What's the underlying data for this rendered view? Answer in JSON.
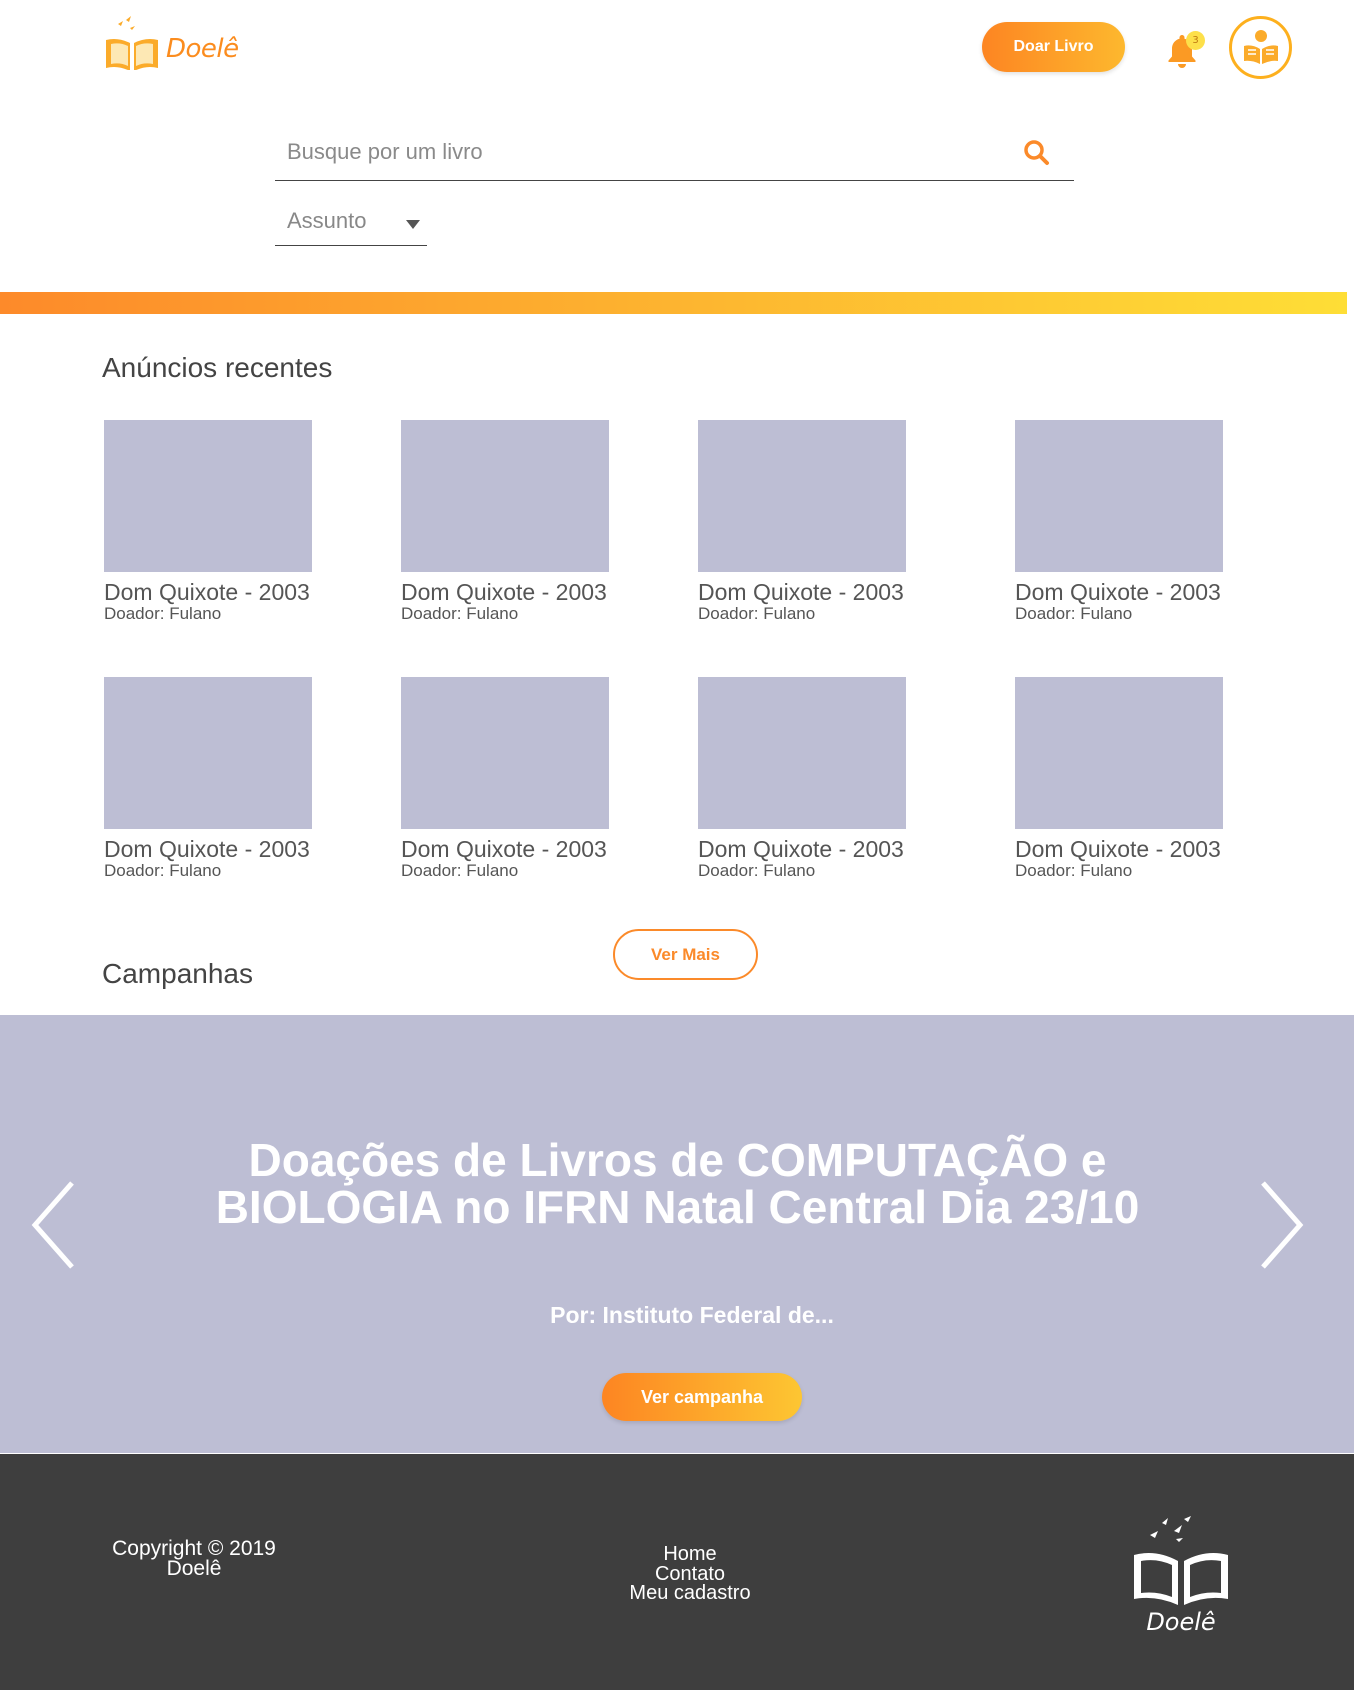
{
  "header": {
    "logo_text": "Doelê",
    "donate_button": "Doar Livro",
    "notification_count": "3"
  },
  "search": {
    "placeholder": "Busque por um livro",
    "subject_label": "Assunto"
  },
  "recent": {
    "title": "Anúncios recentes",
    "books": [
      {
        "title": "Dom Quixote - 2003",
        "donor": "Doador: Fulano"
      },
      {
        "title": "Dom Quixote - 2003",
        "donor": "Doador: Fulano"
      },
      {
        "title": "Dom Quixote - 2003",
        "donor": "Doador: Fulano"
      },
      {
        "title": "Dom Quixote - 2003",
        "donor": "Doador: Fulano"
      },
      {
        "title": "Dom Quixote - 2003",
        "donor": "Doador: Fulano"
      },
      {
        "title": "Dom Quixote - 2003",
        "donor": "Doador: Fulano"
      },
      {
        "title": "Dom Quixote - 2003",
        "donor": "Doador: Fulano"
      },
      {
        "title": "Dom Quixote - 2003",
        "donor": "Doador: Fulano"
      }
    ],
    "more_button": "Ver Mais"
  },
  "campaigns": {
    "title": "Campanhas",
    "banner_title": "Doações de Livros de COMPUTAÇÃO e BIOLOGIA no IFRN Natal Central Dia 23/10",
    "banner_by": "Por: Instituto Federal de...",
    "banner_button": "Ver campanha"
  },
  "footer": {
    "copyright_line1": "Copyright © 2019",
    "copyright_line2": "Doelê",
    "links": [
      "Home",
      "Contato",
      "Meu cadastro"
    ],
    "logo_text": "Doelê"
  },
  "colors": {
    "accent_orange": "#fb8a2a",
    "accent_yellow": "#fede36",
    "placeholder_gray": "#bdbed4",
    "footer_bg": "#3e3e3e"
  },
  "icons": [
    "logo-book-icon",
    "bell-icon",
    "reader-avatar-icon",
    "search-icon",
    "chevron-down-icon",
    "chevron-left-icon",
    "chevron-right-icon",
    "footer-logo-icon"
  ]
}
